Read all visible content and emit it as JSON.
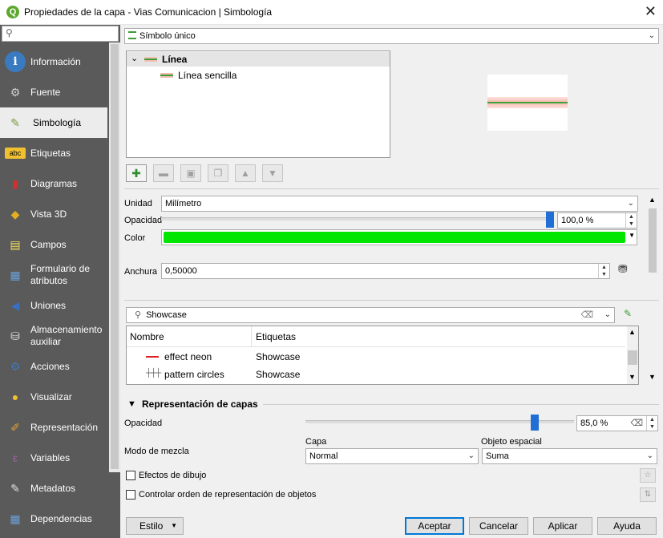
{
  "window": {
    "title": "Propiedades de la capa - Vias Comunicacion | Simbología",
    "app_icon": "Q"
  },
  "sidebar": {
    "items": [
      {
        "label": "Información",
        "icon": "info-icon",
        "glyph": "i",
        "color": "#3a7ac0"
      },
      {
        "label": "Fuente",
        "icon": "wrench-icon",
        "glyph": "⚙",
        "color": "#d0d0d0"
      },
      {
        "label": "Simbología",
        "icon": "paintbrush-icon",
        "glyph": "✎",
        "color": "#7a9a3a",
        "active": true
      },
      {
        "label": "Etiquetas",
        "icon": "abc-label-icon",
        "glyph": "abc",
        "color": "#f0c030"
      },
      {
        "label": "Diagramas",
        "icon": "diagram-icon",
        "glyph": "▮",
        "color": "#d03030"
      },
      {
        "label": "Vista 3D",
        "icon": "cube-icon",
        "glyph": "◆",
        "color": "#e0b020"
      },
      {
        "label": "Campos",
        "icon": "fields-icon",
        "glyph": "▤",
        "color": "#f0e060"
      },
      {
        "label": "Formulario de atributos",
        "icon": "form-icon",
        "glyph": "▦",
        "color": "#6aa0d8"
      },
      {
        "label": "Uniones",
        "icon": "join-icon",
        "glyph": "◀",
        "color": "#3a6fc0"
      },
      {
        "label": "Almacenamiento auxiliar",
        "icon": "database-icon",
        "glyph": "⛁",
        "color": "#dcdcdc"
      },
      {
        "label": "Acciones",
        "icon": "actions-icon",
        "glyph": "⚙",
        "color": "#3a7ac0"
      },
      {
        "label": "Visualizar",
        "icon": "speech-bubble-icon",
        "glyph": "●",
        "color": "#f0c030"
      },
      {
        "label": "Representación",
        "icon": "render-brush-icon",
        "glyph": "✐",
        "color": "#e0a030"
      },
      {
        "label": "Variables",
        "icon": "epsilon-icon",
        "glyph": "ε",
        "color": "#a060a0"
      },
      {
        "label": "Metadatos",
        "icon": "metadata-icon",
        "glyph": "✎",
        "color": "#e0e0e0"
      },
      {
        "label": "Dependencias",
        "icon": "dependencies-icon",
        "glyph": "▦",
        "color": "#6aa0d8"
      }
    ]
  },
  "renderer": {
    "type": "Símbolo único"
  },
  "symbol_tree": {
    "root": "Línea",
    "child": "Línea sencilla"
  },
  "properties": {
    "unit_label": "Unidad",
    "unit_value": "Milímetro",
    "opacity_label": "Opacidad",
    "opacity_value": "100,0 %",
    "opacity_fraction": 1.0,
    "color_label": "Color",
    "color_value": "#00e600",
    "width_label": "Anchura",
    "width_value": "0,50000"
  },
  "library": {
    "search_value": "Showcase",
    "col_name": "Nombre",
    "col_tags": "Etiquetas",
    "rows": [
      {
        "name": "effect neon",
        "tags": "Showcase"
      },
      {
        "name": "pattern circles",
        "tags": "Showcase"
      }
    ]
  },
  "layer_rendering": {
    "section_title": "Representación de capas",
    "opacity_label": "Opacidad",
    "opacity_value": "85,0 %",
    "opacity_fraction": 0.85,
    "blend_label": "Modo de mezcla",
    "layer_label": "Capa",
    "layer_value": "Normal",
    "feature_label": "Objeto espacial",
    "feature_value": "Suma",
    "draw_effects_label": "Efectos de dibujo",
    "feature_order_label": "Controlar orden de representación de objetos"
  },
  "footer": {
    "style": "Estilo",
    "ok": "Aceptar",
    "cancel": "Cancelar",
    "apply": "Aplicar",
    "help": "Ayuda"
  }
}
